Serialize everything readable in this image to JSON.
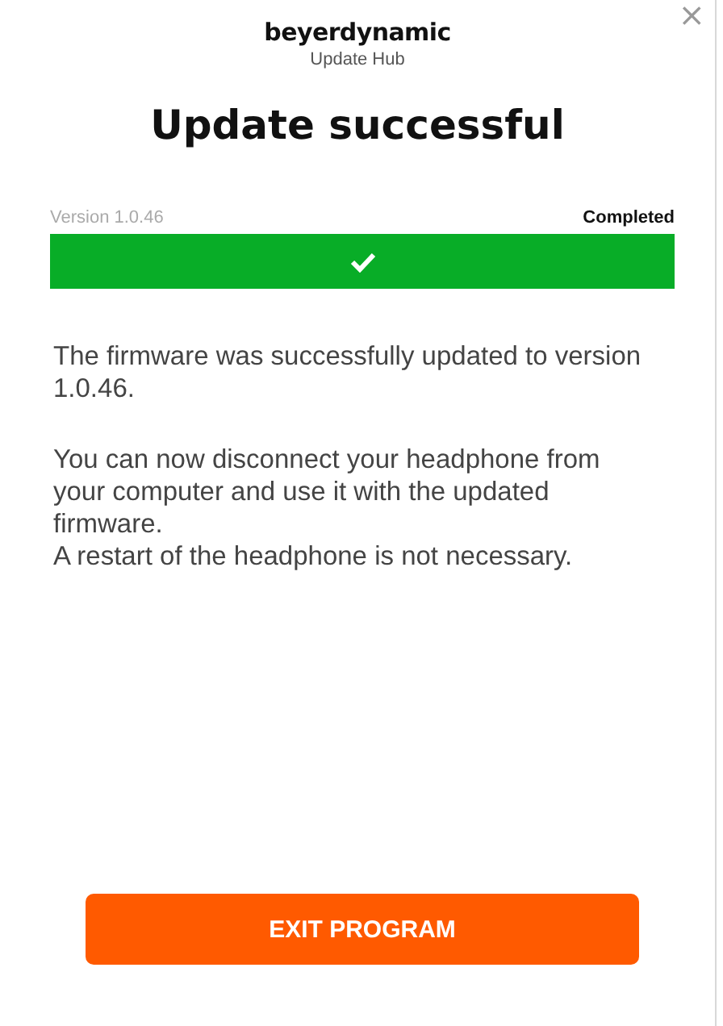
{
  "window": {
    "close": "×"
  },
  "header": {
    "brand": "beyerdynamic",
    "subtitle": "Update Hub"
  },
  "title": "Update successful",
  "progress": {
    "version": "Version 1.0.46",
    "status": "Completed",
    "level": 1.0,
    "done": true
  },
  "paragraphs": [
    [
      "The firmware was successfully updated to version 1.0.46."
    ],
    [
      "You can now disconnect your headphone from your computer and use it with the updated firmware.",
      "A restart of the headphone is not necessary."
    ]
  ],
  "button": "EXIT PROGRAM"
}
